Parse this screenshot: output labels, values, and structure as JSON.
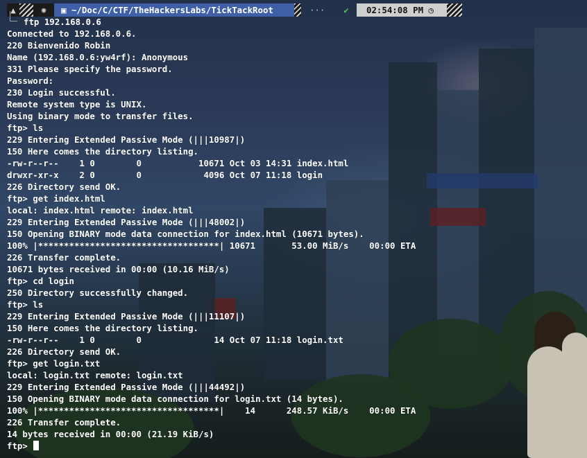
{
  "prompt": {
    "os_icon": "arch-linux-icon",
    "app_icon": "tux-icon",
    "folder_icon": "folder-icon",
    "path": "~/Doc/C/CTF/TheHackersLabs/TickTackRoot",
    "dots": "···",
    "status_icon": "check-icon",
    "status_symbol": "✔",
    "time": "02:54:08 PM",
    "clock_icon": "clock-icon",
    "command": "ftp 192.168.0.6"
  },
  "terminal": {
    "lines": [
      "Connected to 192.168.0.6.",
      "220 Bienvenido Robin",
      "Name (192.168.0.6:yw4rf): Anonymous",
      "331 Please specify the password.",
      "Password:",
      "230 Login successful.",
      "Remote system type is UNIX.",
      "Using binary mode to transfer files.",
      "ftp> ls",
      "229 Entering Extended Passive Mode (|||10987|)",
      "150 Here comes the directory listing.",
      "-rw-r--r--    1 0        0           10671 Oct 03 14:31 index.html",
      "drwxr-xr-x    2 0        0            4096 Oct 07 11:18 login",
      "226 Directory send OK.",
      "ftp> get index.html",
      "local: index.html remote: index.html",
      "229 Entering Extended Passive Mode (|||48002|)",
      "150 Opening BINARY mode data connection for index.html (10671 bytes).",
      "100% |***********************************| 10671       53.00 MiB/s    00:00 ETA",
      "226 Transfer complete.",
      "10671 bytes received in 00:00 (10.16 MiB/s)",
      "ftp> cd login",
      "250 Directory successfully changed.",
      "ftp> ls",
      "229 Entering Extended Passive Mode (|||11107|)",
      "150 Here comes the directory listing.",
      "-rw-r--r--    1 0        0              14 Oct 07 11:18 login.txt",
      "226 Directory send OK.",
      "ftp> get login.txt",
      "local: login.txt remote: login.txt",
      "229 Entering Extended Passive Mode (|||44492|)",
      "150 Opening BINARY mode data connection for login.txt (14 bytes).",
      "100% |***********************************|    14      248.57 KiB/s    00:00 ETA",
      "226 Transfer complete.",
      "14 bytes received in 00:00 (21.19 KiB/s)"
    ],
    "current_prompt": "ftp> ",
    "current_input": ""
  },
  "colors": {
    "text": "#ffffff",
    "path_segment": "#3f5fa6",
    "time_segment": "#cfcfcf",
    "status_ok": "#55c255"
  }
}
